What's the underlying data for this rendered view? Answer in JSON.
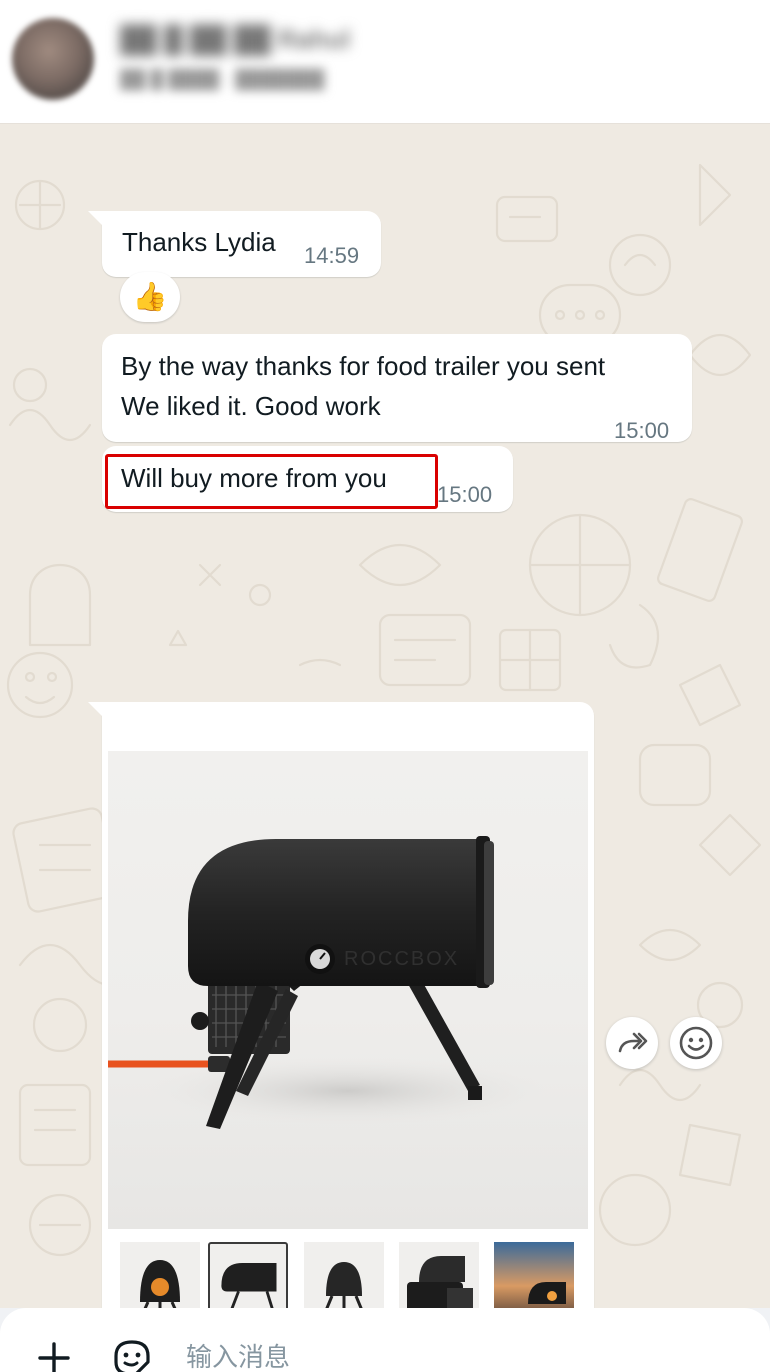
{
  "header": {
    "contact_name": "██ █ ██ ██ Rahul",
    "contact_status": "██ █ ████ · ███████"
  },
  "messages": [
    {
      "text": "Thanks Lydia",
      "time": "14:59",
      "reaction": "👍"
    },
    {
      "lines": [
        "By the way thanks for food trailer you sent",
        "We liked it. Good work"
      ],
      "time": "15:00"
    },
    {
      "text": "Will buy more from you",
      "time": "15:00",
      "highlighted": true
    }
  ],
  "image_message": {
    "product_brand": "ROCCBOX",
    "thumbnails": [
      "oven-front-lit",
      "oven-side",
      "oven-rear",
      "oven-accessories",
      "oven-outdoor-sunset"
    ],
    "selected_thumbnail": 1
  },
  "actions": {
    "forward_icon": "forward-icon",
    "react_icon": "emoji-icon"
  },
  "composer": {
    "placeholder": "输入消息",
    "attach_icon": "plus-icon",
    "sticker_icon": "sticker-icon"
  },
  "colors": {
    "chat_bg": "#efeae2",
    "bubble_bg": "#ffffff",
    "timestamp": "#667781",
    "highlight": "#d90000",
    "hose": "#e8521e"
  }
}
